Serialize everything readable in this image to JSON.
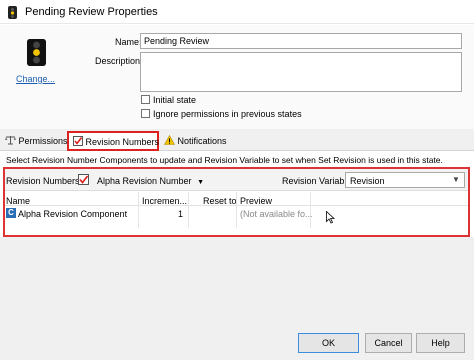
{
  "window": {
    "title": "Pending Review Properties",
    "icon": "traffic-light-icon"
  },
  "general": {
    "change_link": "Change...",
    "name_label": "Name:",
    "name_value": "Pending Review",
    "description_label": "Description:",
    "description_value": "",
    "initial_state_label": "Initial state",
    "initial_state_checked": false,
    "ignore_permissions_label": "Ignore permissions in previous states",
    "ignore_permissions_checked": false
  },
  "tabs": [
    {
      "label": "Permissions",
      "icon": "scale-icon",
      "selected": false
    },
    {
      "label": "Revision Numbers",
      "icon": "checkbox-icon",
      "selected": true
    },
    {
      "label": "Notifications",
      "icon": "warning-icon",
      "selected": false
    }
  ],
  "hint_text": "Select Revision Number Components to update and Revision Variable to set when Set Revision is used in this state.",
  "revision": {
    "numbers_label": "Revision Numbers:",
    "numbers_checked": true,
    "dropdown_value": "Alpha Revision Number",
    "variable_label": "Revision Variable:",
    "variable_value": "Revision",
    "columns": [
      "Name",
      "Incremen...",
      "Reset to",
      "Preview"
    ],
    "rows": [
      {
        "icon": "C",
        "name": "Alpha Revision Component",
        "increment": "1",
        "reset_to": "",
        "preview": "(Not available fo..."
      }
    ]
  },
  "buttons": {
    "ok": "OK",
    "cancel": "Cancel",
    "help": "Help"
  },
  "colors": {
    "highlight_red": "#d22222",
    "link_blue": "#1a5fb4"
  }
}
